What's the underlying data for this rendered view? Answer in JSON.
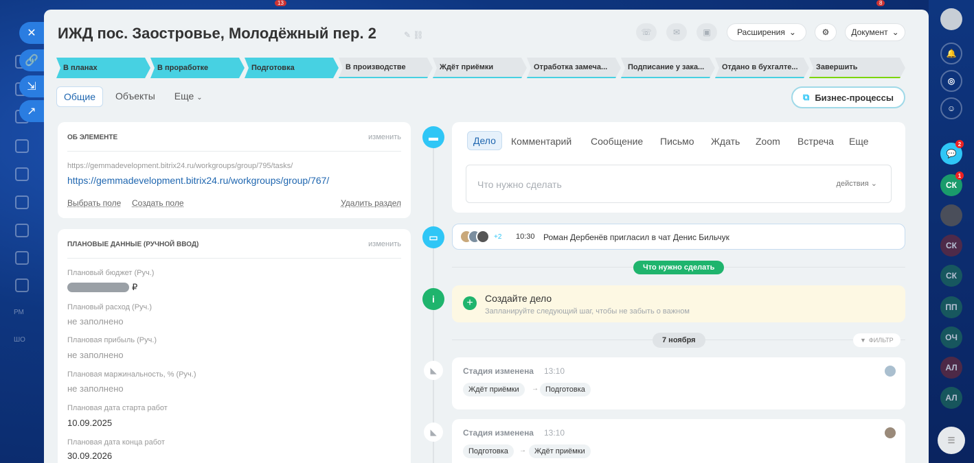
{
  "left_rail": {
    "labels": [
      "РМ",
      "ШО"
    ]
  },
  "top_strip": {
    "badges": [
      "13",
      "8"
    ]
  },
  "header": {
    "title": "ИЖД пос. Заостровье, Молодёжный пер. 2",
    "extensions_label": "Расширения",
    "document_label": "Документ"
  },
  "stages": [
    {
      "label": "В планах",
      "state": "done"
    },
    {
      "label": "В проработке",
      "state": "done"
    },
    {
      "label": "Подготовка",
      "state": "done"
    },
    {
      "label": "В производстве",
      "state": "todo"
    },
    {
      "label": "Ждёт приёмки",
      "state": "todo"
    },
    {
      "label": "Отработка замеча...",
      "state": "todo"
    },
    {
      "label": "Подписание у зака...",
      "state": "todo"
    },
    {
      "label": "Отдано в бухгалте...",
      "state": "todo"
    },
    {
      "label": "Завершить",
      "state": "final"
    }
  ],
  "tabs": {
    "general": "Общие",
    "objects": "Объекты",
    "more": "Еще"
  },
  "bp_button": "Бизнес-процессы",
  "about": {
    "title": "ОБ ЭЛЕМЕНТЕ",
    "edit": "изменить",
    "url_small": "https://gemmadevelopment.bitrix24.ru/workgroups/group/795/tasks/",
    "url_link": "https://gemmadevelopment.bitrix24.ru/workgroups/group/767/",
    "select_field": "Выбрать поле",
    "create_field": "Создать поле",
    "delete_section": "Удалить раздел"
  },
  "plan": {
    "title": "ПЛАНОВЫЕ ДАННЫЕ (РУЧНОЙ ВВОД)",
    "edit": "изменить",
    "fields": [
      {
        "label": "Плановый бюджет (Руч.)",
        "value": "₽"
      },
      {
        "label": "Плановый расход (Руч.)",
        "value": "не заполнено"
      },
      {
        "label": "Плановая прибыль (Руч.)",
        "value": "не заполнено"
      },
      {
        "label": "Плановая маржинальность, % (Руч.)",
        "value": "не заполнено"
      },
      {
        "label": "Плановая дата старта работ",
        "value": "10.09.2025"
      },
      {
        "label": "Плановая дата конца работ",
        "value": "30.09.2026"
      }
    ]
  },
  "activity": {
    "tabs": [
      "Дело",
      "Комментарий",
      "Сообщение",
      "Письмо",
      "Ждать",
      "Zoom",
      "Встреча",
      "Еще"
    ],
    "placeholder": "Что нужно сделать",
    "actions": "действия"
  },
  "chat": {
    "more_count": "+2",
    "time": "10:30",
    "text": "Роман Дербенёв пригласил в чат Денис Бильчук"
  },
  "todo_badge": "Что нужно сделать",
  "create_task": {
    "title": "Создайте дело",
    "hint": "Запланируйте следующий шаг, чтобы не забыть о важном"
  },
  "date_sep": "7 ноября",
  "filter": "ФИЛЬТР",
  "history": [
    {
      "title": "Стадия изменена",
      "time": "13:10",
      "from": "Ждёт приёмки",
      "to": "Подготовка"
    },
    {
      "title": "Стадия изменена",
      "time": "13:10",
      "from": "Подготовка",
      "to": "Ждёт приёмки"
    }
  ],
  "right_rail": [
    {
      "label": "",
      "badge": "2",
      "color": "#2fc6f6"
    },
    {
      "label": "СК",
      "badge": "1",
      "color": "#1a9b6b"
    },
    {
      "label": "",
      "badge": "",
      "color": "#4a4e5a"
    },
    {
      "label": "СК",
      "badge": "",
      "color": "#7a2a3a"
    },
    {
      "label": "СК",
      "badge": "",
      "color": "#2a6a5a"
    },
    {
      "label": "ПП",
      "badge": "",
      "color": "#2a6a5a"
    },
    {
      "label": "ОЧ",
      "badge": "",
      "color": "#2a6a5a"
    },
    {
      "label": "АЛ",
      "badge": "",
      "color": "#7a2a3a"
    },
    {
      "label": "АЛ",
      "badge": "",
      "color": "#2a6a5a"
    }
  ]
}
